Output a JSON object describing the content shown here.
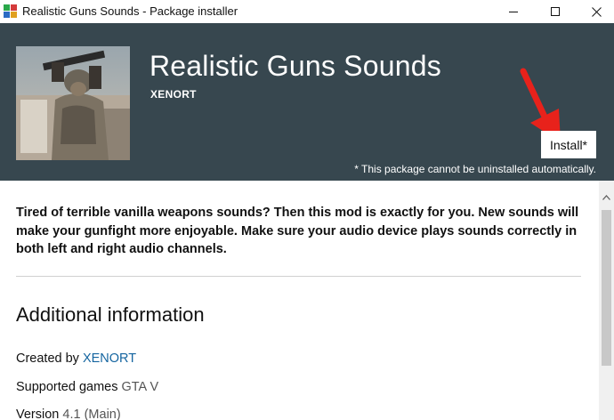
{
  "window": {
    "title": "Realistic Guns Sounds - Package installer",
    "controls": [
      "minimize",
      "maximize",
      "close"
    ]
  },
  "header": {
    "package_title": "Realistic Guns Sounds",
    "author": "XENORT",
    "install_label": "Install*",
    "install_note": "* This package cannot be uninstalled automatically."
  },
  "content": {
    "description": "Tired of terrible vanilla weapons sounds? Then this mod is exactly for you. New sounds will make your gunfight more enjoyable. Make sure your audio device plays sounds correctly in both left and right audio channels.",
    "section_heading": "Additional information",
    "info": {
      "created_by_label": "Created by",
      "created_by_value": "XENORT",
      "games_label": "Supported games",
      "games_value": "GTA V",
      "version_label": "Version",
      "version_value": "4.1 (Main)"
    }
  },
  "colors": {
    "header_bg": "#37474f",
    "link": "#1565a0",
    "annotation_arrow": "#e8221b"
  }
}
